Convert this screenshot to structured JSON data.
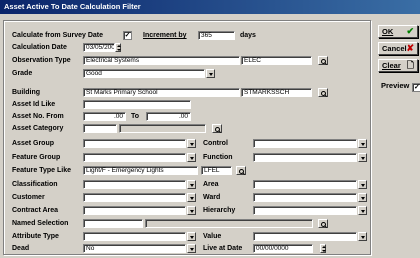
{
  "window": {
    "title": "Asset Active To Date Calculation Filter"
  },
  "form": {
    "calc_from_survey_label": "Calculate from Survey Date",
    "calc_from_survey_checked": "✓",
    "increment_label": "Increment by",
    "increment_value": "365",
    "increment_unit": "days",
    "calc_date_label": "Calculation Date",
    "calc_date_value": "03/05/2002",
    "observation_type_label": "Observation Type",
    "observation_type_value": "Electrical Systems",
    "observation_type_code": "ELEC",
    "grade_label": "Grade",
    "grade_value": "Good",
    "building_label": "Building",
    "building_value": "St Marks Primary School",
    "building_code": "STMARKSSCH",
    "asset_id_like_label": "Asset Id Like",
    "asset_id_like_value": "",
    "asset_no_from_label": "Asset No. From",
    "asset_no_from_value": ".00",
    "to_label": "To",
    "asset_no_to_value": ".00",
    "asset_category_label": "Asset Category",
    "asset_category_value": "",
    "asset_group_label": "Asset Group",
    "asset_group_value": "",
    "control_label": "Control",
    "control_value": "",
    "feature_group_label": "Feature Group",
    "feature_group_value": "",
    "function_label": "Function",
    "function_value": "",
    "feature_type_like_label": "Feature Type Like",
    "feature_type_like_value": "Light/F - Emergency Lights",
    "feature_type_code": "LFEL",
    "classification_label": "Classification",
    "classification_value": "",
    "area_label": "Area",
    "area_value": "",
    "customer_label": "Customer",
    "customer_value": "",
    "ward_label": "Ward",
    "ward_value": "",
    "contract_area_label": "Contract Area",
    "contract_area_value": "",
    "hierarchy_label": "Hierarchy",
    "hierarchy_value": "",
    "named_selection_label": "Named Selection",
    "named_selection_value": "",
    "attribute_type_label": "Attribute Type",
    "attribute_type_value": "",
    "value_label": "Value",
    "value_value": "",
    "dead_label": "Dead",
    "dead_value": "No",
    "live_at_date_label": "Live at Date",
    "live_at_date_value": "00/00/0000"
  },
  "buttons": {
    "ok_label": "OK",
    "cancel_label": "Cancel",
    "clear_label": "Clear",
    "preview_label": "Preview",
    "preview_checked": "✓"
  },
  "colors": {
    "title_bar": "#0a246a",
    "face": "#d4d0c8",
    "ok_icon": "#008000",
    "cancel_icon": "#c00000"
  },
  "icons": [
    "check-icon",
    "cancel-x-icon",
    "clear-page-icon",
    "lookup-icon",
    "dropdown-arrow-icon",
    "spin-icon"
  ]
}
